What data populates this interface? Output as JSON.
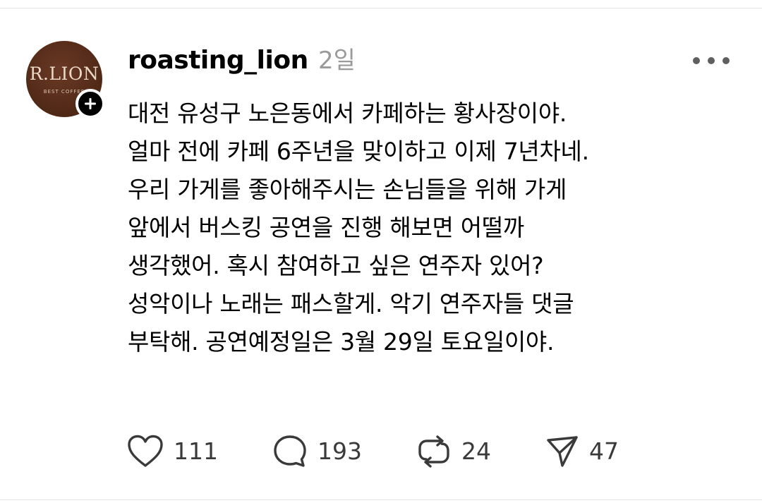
{
  "post": {
    "avatar": {
      "logo_text": "R.LION",
      "logo_subtext": "BEST COFFEE"
    },
    "username": "roasting_lion",
    "time_ago": "2일",
    "body_lines": [
      "대전 유성구 노은동에서 카페하는 황사장이야.",
      "얼마 전에 카페 6주년을 맞이하고 이제 7년차네.",
      "우리 가게를 좋아해주시는 손님들을 위해 가게",
      "앞에서 버스킹 공연을 진행 해보면 어떨까",
      "생각했어. 혹시 참여하고 싶은 연주자 있어?",
      "성악이나 노래는 패스할게. 악기 연주자들 댓글",
      "부탁해. 공연예정일은 3월 29일 토요일이야."
    ],
    "actions": {
      "like": {
        "icon": "heart-icon",
        "count": "111"
      },
      "comment": {
        "icon": "comment-icon",
        "count": "193"
      },
      "repost": {
        "icon": "repost-icon",
        "count": "24"
      },
      "share": {
        "icon": "send-icon",
        "count": "47"
      }
    }
  },
  "colors": {
    "text": "#000000",
    "secondary_text": "#9a9a9a",
    "icon": "#3a3a3a",
    "avatar_bg": "#532a18",
    "divider": "#e6e6e6"
  }
}
